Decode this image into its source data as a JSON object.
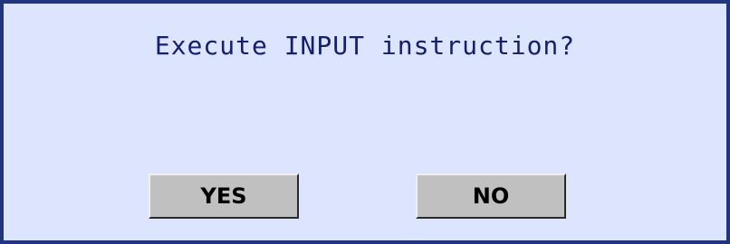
{
  "dialog": {
    "message": "Execute INPUT instruction?",
    "yes_label": "YES",
    "no_label": "NO"
  },
  "colors": {
    "background": "#dde4fd",
    "border": "#1f3580",
    "text": "#14206e",
    "button_face": "#c0c0c0"
  }
}
